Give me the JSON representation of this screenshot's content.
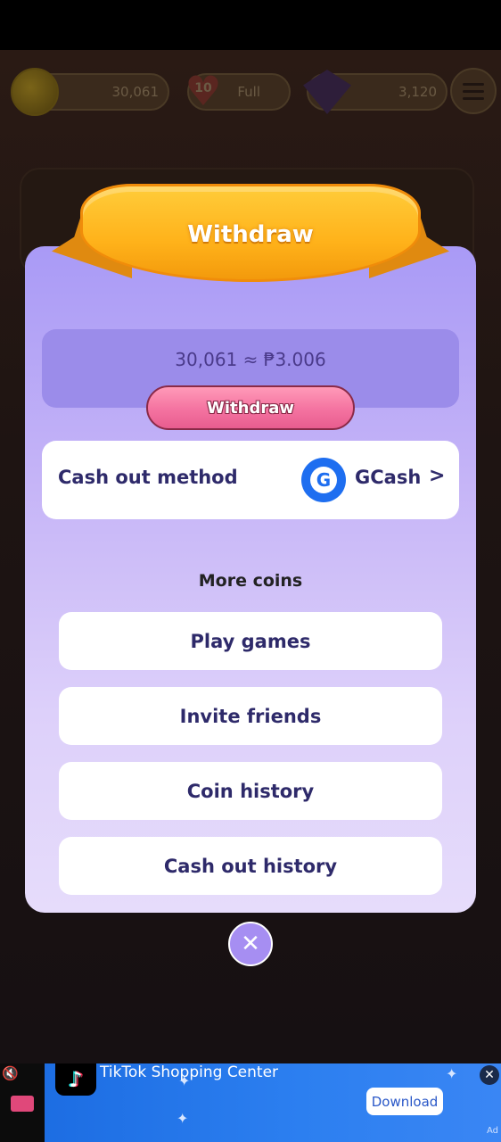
{
  "hud": {
    "coins": "30,061",
    "lives_count": "10",
    "lives_status": "Full",
    "gems": "3,120"
  },
  "dialog": {
    "title": "Withdraw",
    "balance_text": "30,061 ≈ ₱3.006",
    "withdraw_button": "Withdraw",
    "cash_out_method_label": "Cash out method",
    "cash_out_method_value": "GCash",
    "cash_out_method_chevron": ">",
    "gcash_logo_letter": "G",
    "more_coins_heading": "More coins",
    "options": [
      {
        "label": "Play games"
      },
      {
        "label": "Invite friends"
      },
      {
        "label": "Coin history"
      },
      {
        "label": "Cash out history"
      }
    ],
    "close_symbol": "✕"
  },
  "ad": {
    "title": "TikTok Shopping Center",
    "download_button": "Download",
    "ad_label": "Ad",
    "close_symbol": "✕",
    "mute_symbol": "🔇"
  },
  "colors": {
    "dialog_top": "#a99af6",
    "dialog_bottom": "#e6dcfb",
    "ribbon": "#ffb21a",
    "withdraw_button": "#f472a0",
    "text_dark_indigo": "#2e2a6a",
    "gcash_blue": "#1e6ef0",
    "ad_blue": "#2c7ff0"
  }
}
